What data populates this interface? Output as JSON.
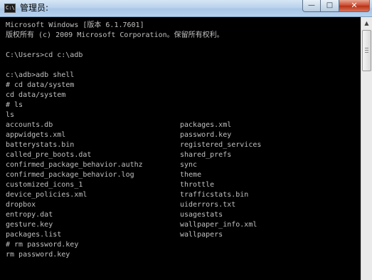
{
  "window": {
    "icon_text": "C:\\",
    "title": "管理员:",
    "controls": {
      "minimize": "—",
      "maximize": "□",
      "close": "✕"
    }
  },
  "console": {
    "lines": [
      "Microsoft Windows [版本 6.1.7601]",
      "版权所有 (c) 2009 Microsoft Corporation。保留所有权利。",
      "",
      "C:\\Users>cd c:\\adb",
      "",
      "c:\\adb>adb shell",
      "# cd data/system",
      "cd data/system",
      "# ls",
      "ls"
    ],
    "listing_left": [
      "accounts.db",
      "appwidgets.xml",
      "batterystats.bin",
      "called_pre_boots.dat",
      "confirmed_package_behavior.authz",
      "confirmed_package_behavior.log",
      "customized_icons_1",
      "device_policies.xml",
      "dropbox",
      "entropy.dat",
      "gesture.key",
      "packages.list"
    ],
    "listing_right": [
      "packages.xml",
      "password.key",
      "registered_services",
      "shared_prefs",
      "sync",
      "theme",
      "throttle",
      "trafficstats.bin",
      "uiderrors.txt",
      "usagestats",
      "wallpaper_info.xml",
      "wallpapers"
    ],
    "after_lines": [
      "# rm password.key",
      "rm password.key"
    ],
    "text_color": "#c0c0c0",
    "background_color": "#000000"
  },
  "scrollbar": {
    "up_arrow": "▲"
  }
}
